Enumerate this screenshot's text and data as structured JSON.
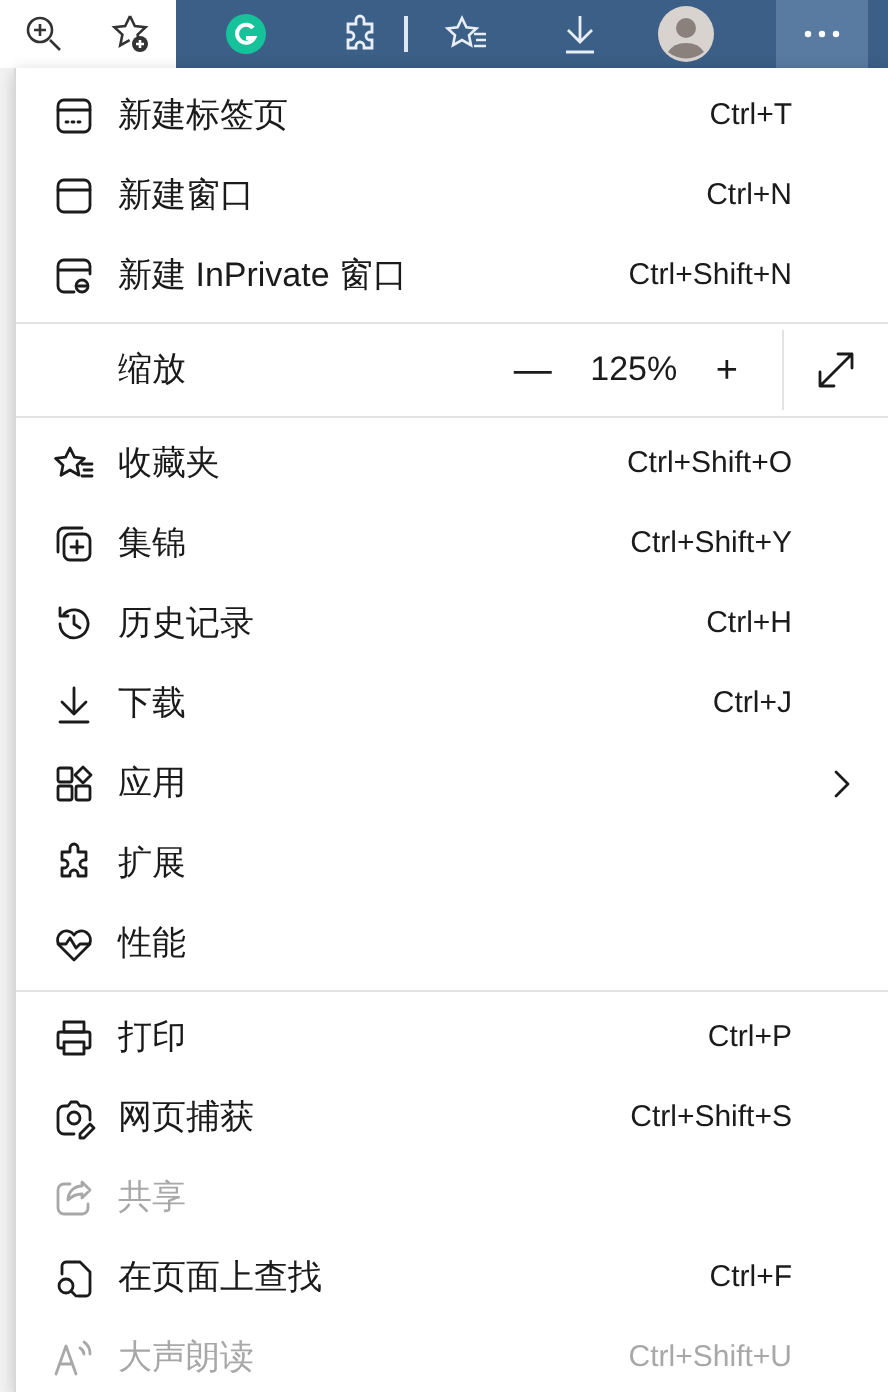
{
  "menu": [
    {
      "kind": "item",
      "label": "新建标签页",
      "shortcut": "Ctrl+T",
      "disabled": false
    },
    {
      "kind": "item",
      "label": "新建窗口",
      "shortcut": "Ctrl+N",
      "disabled": false
    },
    {
      "kind": "item",
      "label": "新建 InPrivate 窗口",
      "shortcut": "Ctrl+Shift+N",
      "disabled": false
    },
    {
      "kind": "divider"
    },
    {
      "kind": "zoom",
      "label": "缩放",
      "minus": "—",
      "value": "125%",
      "plus": "+"
    },
    {
      "kind": "divider"
    },
    {
      "kind": "item",
      "label": "收藏夹",
      "shortcut": "Ctrl+Shift+O",
      "disabled": false
    },
    {
      "kind": "item",
      "label": "集锦",
      "shortcut": "Ctrl+Shift+Y",
      "disabled": false
    },
    {
      "kind": "item",
      "label": "历史记录",
      "shortcut": "Ctrl+H",
      "disabled": false
    },
    {
      "kind": "item",
      "label": "下载",
      "shortcut": "Ctrl+J",
      "disabled": false
    },
    {
      "kind": "item",
      "label": "应用",
      "submenu": true,
      "disabled": false
    },
    {
      "kind": "item",
      "label": "扩展",
      "disabled": false
    },
    {
      "kind": "item",
      "label": "性能",
      "disabled": false
    },
    {
      "kind": "divider"
    },
    {
      "kind": "item",
      "label": "打印",
      "shortcut": "Ctrl+P",
      "disabled": false
    },
    {
      "kind": "item",
      "label": "网页捕获",
      "shortcut": "Ctrl+Shift+S",
      "disabled": false
    },
    {
      "kind": "item",
      "label": "共享",
      "disabled": true
    },
    {
      "kind": "item",
      "label": "在页面上查找",
      "shortcut": "Ctrl+F",
      "disabled": false
    },
    {
      "kind": "item",
      "label": "大声朗读",
      "shortcut": "Ctrl+Shift+U",
      "disabled": true
    }
  ]
}
